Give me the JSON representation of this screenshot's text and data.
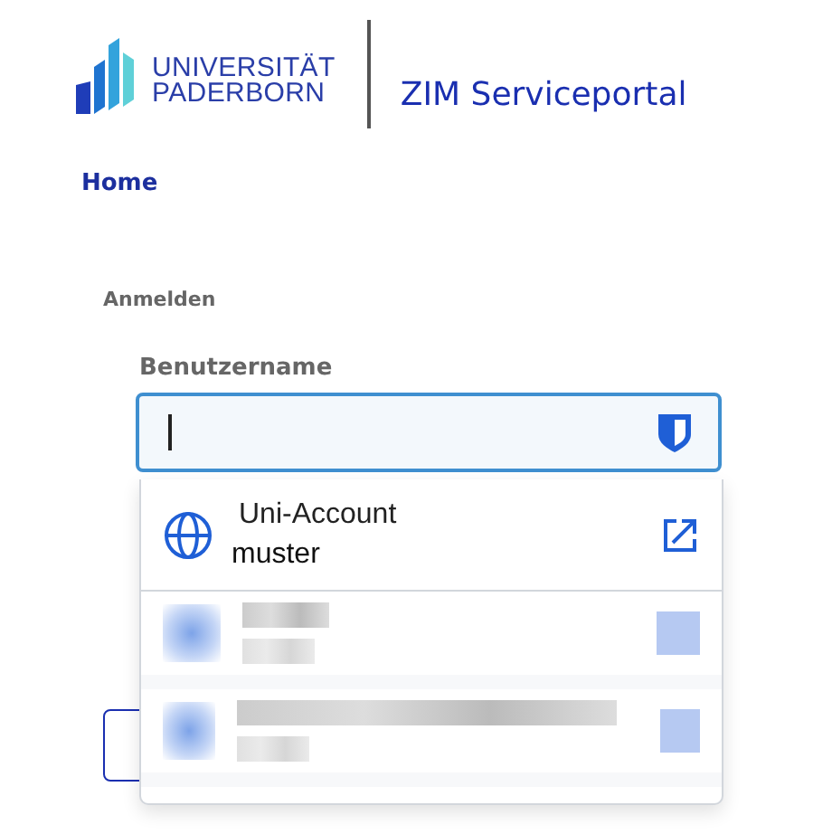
{
  "header": {
    "university_line1": "UNIVERSITÄT",
    "university_line2": "PADERBORN",
    "portal_title": "ZIM Serviceportal"
  },
  "nav": {
    "home": "Home"
  },
  "form": {
    "section": "Anmelden",
    "username_label": "Benutzername"
  },
  "autofill": {
    "items": [
      {
        "kind": "account",
        "title": "Uni-Account",
        "username": "muster"
      },
      {
        "kind": "redacted"
      },
      {
        "kind": "redacted"
      }
    ]
  }
}
